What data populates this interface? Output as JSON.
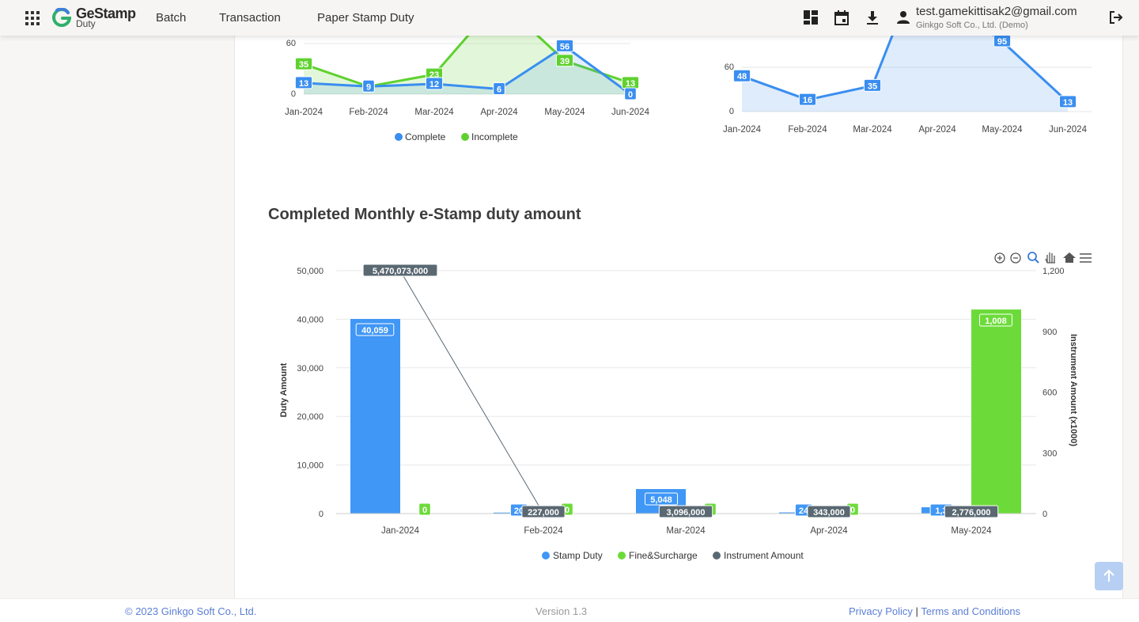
{
  "nav": {
    "logo_name": "GeStamp",
    "logo_sub": "Duty",
    "items": [
      "Batch",
      "Transaction",
      "Paper Stamp Duty"
    ],
    "user_email": "test.gamekittisak2@gmail.com",
    "user_org": "Ginkgo Soft Co., Ltd. (Demo)",
    "icons": [
      "dashboard-icon",
      "calendar-icon",
      "download-icon",
      "user-icon",
      "logout-icon",
      "apps-grid-icon"
    ]
  },
  "section_title": "Completed Monthly e-Stamp duty amount",
  "toolbar_icons": [
    "zoom-in-icon",
    "zoom-out-icon",
    "selection-zoom-icon",
    "pan-hand-icon",
    "home-reset-icon",
    "menu-icon"
  ],
  "colors": {
    "complete": "#3a8ef0",
    "incomplete": "#5fd12f",
    "stamp_duty": "#4097f5",
    "fine_surcharge": "#6cdb3a",
    "instrument": "#5a6872",
    "link": "#5b7fd6"
  },
  "chart_data": [
    {
      "type": "area",
      "categories": [
        "Jan-2024",
        "Feb-2024",
        "Mar-2024",
        "Apr-2024",
        "May-2024",
        "Jun-2024"
      ],
      "series": [
        {
          "name": "Complete",
          "values": [
            13,
            9,
            12,
            6,
            56,
            0
          ]
        },
        {
          "name": "Incomplete",
          "values": [
            35,
            9,
            23,
            null,
            39,
            13
          ]
        }
      ],
      "y_ticks": [
        "0",
        "60"
      ],
      "legend": "bottom"
    },
    {
      "type": "area",
      "categories": [
        "Jan-2024",
        "Feb-2024",
        "Mar-2024",
        "Apr-2024",
        "May-2024",
        "Jun-2024"
      ],
      "series": [
        {
          "values": [
            48,
            16,
            35,
            null,
            95,
            13
          ]
        }
      ],
      "y_ticks": [
        "0",
        "60"
      ]
    },
    {
      "type": "bar",
      "title": "Completed Monthly e-Stamp duty amount",
      "categories": [
        "Jan-2024",
        "Feb-2024",
        "Mar-2024",
        "Apr-2024",
        "May-2024"
      ],
      "ylabel": "Duty Amount",
      "y2label": "Instrument Amount (x1000)",
      "ylim": [
        0,
        50000
      ],
      "y2lim": [
        0,
        1200
      ],
      "y_ticks": [
        "0",
        "10,000",
        "20,000",
        "30,000",
        "40,000",
        "50,000"
      ],
      "y2_ticks": [
        "0",
        "300",
        "600",
        "900",
        "1,200"
      ],
      "series": [
        {
          "name": "Stamp Duty",
          "axis": "left",
          "values": [
            40059,
            205,
            5048,
            240,
            1300
          ],
          "labels": [
            "40,059",
            "20",
            "5,048",
            "24",
            "1,3"
          ]
        },
        {
          "name": "Fine&Surcharge",
          "axis": "right",
          "values": [
            0,
            0,
            0,
            0,
            1008
          ],
          "labels": [
            "0",
            "0",
            "0",
            "0",
            "1,008"
          ]
        },
        {
          "name": "Instrument Amount",
          "axis": "right",
          "values": [
            5470073,
            227,
            3096,
            343,
            2776
          ],
          "labels": [
            "5,470,073,000",
            "227,000",
            "3,096,000",
            "343,000",
            "2,776,000"
          ]
        }
      ],
      "legend": "bottom"
    }
  ],
  "footer": {
    "copyright": "© 2023 Ginkgo Soft Co., Ltd.",
    "version": "Version 1.3",
    "privacy": "Privacy Policy",
    "separator": "|",
    "terms": "Terms and Conditions"
  }
}
